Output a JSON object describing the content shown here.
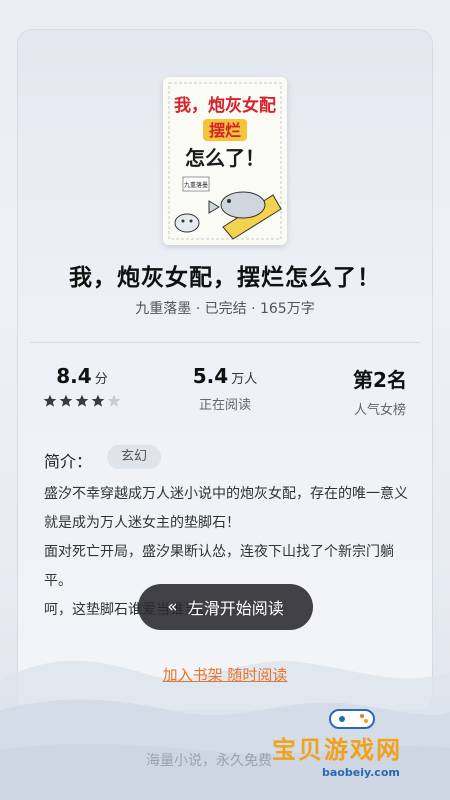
{
  "book": {
    "cover_title_lines": [
      "我，炮灰女配",
      "摆烂",
      "怎么了！"
    ],
    "cover_author": "九重落墨",
    "title": "我，炮灰女配，摆烂怎么了！",
    "meta": "九重落墨 · 已完结 · 165万字"
  },
  "stats": {
    "rating_value": "8.4",
    "rating_unit": "分",
    "rating_stars": 4,
    "rating_stars_max": 5,
    "readers_value": "5.4",
    "readers_unit": "万人",
    "readers_label": "正在阅读",
    "rank_value": "第2名",
    "rank_label": "人气女榜"
  },
  "intro": {
    "label": "简介：",
    "tag": "玄幻",
    "paragraphs": [
      "盛汐不幸穿越成万人迷小说中的炮灰女配，存在的唯一意义就是成为万人迷女主的垫脚石！",
      "面对死亡开局，盛汐果断认怂，连夜下山找了个新宗门躺平。",
      "呵，这垫脚石谁爱当谁当。"
    ]
  },
  "actions": {
    "swipe_chevron": "«",
    "swipe_label": "左滑开始阅读",
    "bookshelf_label": "加入书架 随时阅读"
  },
  "footer": {
    "text": "海量小说，永久免费"
  },
  "watermark": {
    "text": "宝贝游戏网",
    "url": "baobeiy.com"
  },
  "colors": {
    "accent_orange": "#e8742c",
    "star_filled": "#3a3a3a",
    "star_empty": "#c8ccd3"
  }
}
